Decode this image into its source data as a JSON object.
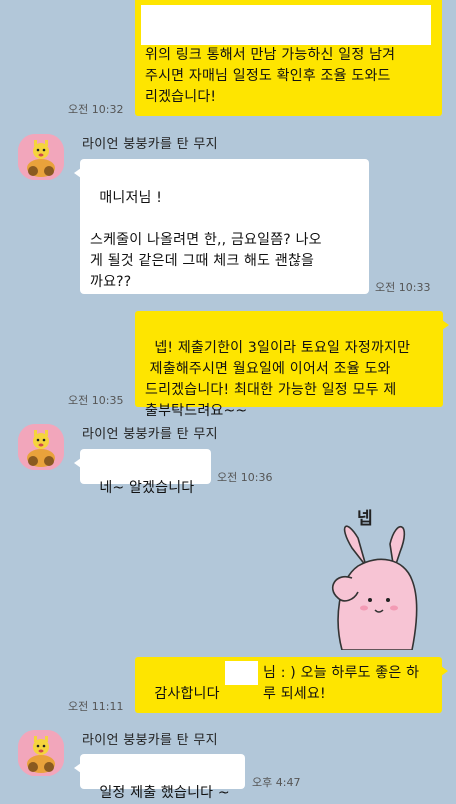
{
  "sender_name": "라이언 붕붕카를 탄 무지",
  "messages": {
    "m1": {
      "text": "위의 링크 통해서 만남 가능하신 일정 남겨\n주시면 자매님 일정도 확인후 조율 도와드\n리겠습니다!",
      "time": "오전 10:32"
    },
    "m2": {
      "text": "매니저님 !\n\n스케줄이 나올려면 한,, 금요일쯤? 나오\n게 될것 같은데 그때 체크 해도 괜찮을\n까요??",
      "time": "오전 10:33"
    },
    "m3": {
      "text": "넵! 제출기한이 3일이라 토요일 자정까지만\n 제출해주시면 월요일에 이어서 조율 도와\n드리겠습니다! 최대한 가능한 일정 모두 제\n출부탁드려요~~",
      "time": "오전 10:35"
    },
    "m4": {
      "text": "네~ 알겠습니다",
      "time": "오전 10:36"
    },
    "sticker": {
      "caption": "넵",
      "icon": "pink-bunny-salute-sticker"
    },
    "m5": {
      "text_before": "감사합니다",
      "text_after": "님 : ) 오늘 하루도 좋은 하\n루 되세요!",
      "time": "오전 11:11"
    },
    "m6": {
      "text": "일정 제출 했습니다 ~",
      "time": "오후 4:47"
    }
  },
  "colors": {
    "background": "#b2c7d9",
    "my_bubble": "#fee500",
    "their_bubble": "#ffffff",
    "avatar_bg": "#f2a6bb"
  }
}
